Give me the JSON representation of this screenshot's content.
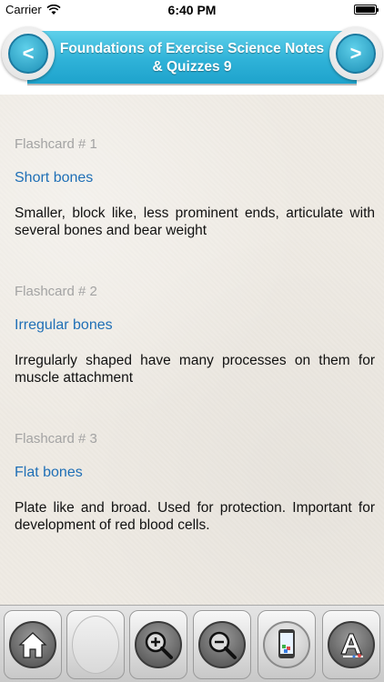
{
  "status_bar": {
    "carrier": "Carrier",
    "time": "6:40 PM"
  },
  "header": {
    "title_line1": "Foundations of Exercise Science Notes",
    "title_line2": "& Quizzes 9",
    "prev_glyph": "<",
    "next_glyph": ">"
  },
  "flashcards": [
    {
      "number": "Flashcard # 1",
      "term": "Short bones",
      "definition": "Smaller, block like, less prominent ends, articulate with several bones and bear weight"
    },
    {
      "number": "Flashcard # 2",
      "term": "Irregular bones",
      "definition": "Irregularly shaped have many processes on them for muscle attachment"
    },
    {
      "number": "Flashcard # 3",
      "term": "Flat bones",
      "definition": "Plate like and broad. Used for protection. Important for development of red blood cells."
    }
  ],
  "toolbar": {
    "items": [
      "home-icon",
      "blank",
      "zoom-in-icon",
      "zoom-out-icon",
      "phone-icon",
      "font-icon"
    ]
  },
  "colors": {
    "header_blue": "#2fb2d8",
    "term_blue": "#1f6fb6",
    "number_gray": "#a3a3a3"
  }
}
